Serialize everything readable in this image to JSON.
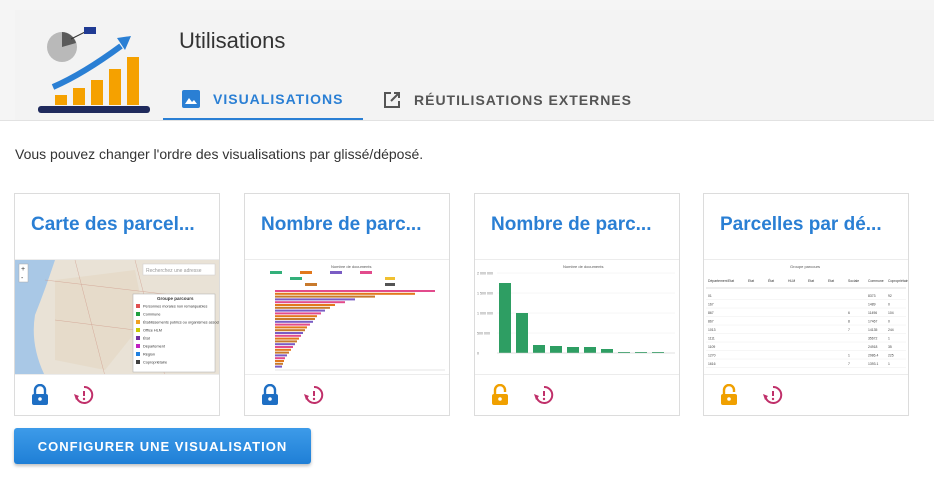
{
  "header": {
    "title": "Utilisations"
  },
  "tabs": [
    {
      "label": "VISUALISATIONS",
      "icon": "image-icon",
      "active": true
    },
    {
      "label": "RÉUTILISATIONS EXTERNES",
      "icon": "external-link-icon",
      "active": false
    }
  ],
  "hint": "Vous pouvez changer l'ordre des visualisations par glissé/déposé.",
  "cards": [
    {
      "title": "Carte des parcel...",
      "thumb_type": "map",
      "thumb": {
        "search_placeholder": "Recherchez une adresse",
        "legend_title": "Groupe parcours",
        "legend": [
          "Personnes morales non remarquables",
          "Commune",
          "Établissements publics ou organismes associés",
          "Office HLM",
          "État",
          "Département",
          "Région",
          "Copropriétaire"
        ],
        "legend_colors": [
          "#e05050",
          "#20a040",
          "#f0a020",
          "#c8c800",
          "#7030a0",
          "#c020c0",
          "#2080e0",
          "#404040"
        ]
      },
      "lock_color": "#1e6fc4",
      "lock_state": "locked"
    },
    {
      "title": "Nombre de parc...",
      "thumb_type": "hbar",
      "thumb": {
        "chart_title": "Nombre de documents"
      },
      "lock_color": "#1e6fc4",
      "lock_state": "locked"
    },
    {
      "title": "Nombre de parc...",
      "thumb_type": "vbar",
      "thumb": {
        "chart_title": "Nombre de documents",
        "y_ticks": [
          "2 000 000",
          "1 500 000",
          "1 000 000",
          "500 000",
          "0"
        ]
      },
      "lock_color": "#f0a000",
      "lock_state": "unlocked"
    },
    {
      "title": "Parcelles par dé...",
      "thumb_type": "table",
      "thumb": {
        "table_title": "Groupe parcours",
        "columns": [
          "Département",
          "Etat",
          "Etat",
          "État",
          "HLM",
          "Etat",
          "Etat",
          "Sociale",
          "Commune",
          "Copropriétaire"
        ],
        "rows": [
          [
            "01",
            "",
            "",
            "",
            "",
            "",
            "",
            "",
            "8373",
            "92"
          ],
          [
            "167",
            "",
            "",
            "",
            "",
            "",
            "",
            "",
            "1489",
            "0"
          ],
          [
            "867",
            "",
            "",
            "",
            "",
            "",
            "",
            "6",
            "11496",
            "104"
          ],
          [
            "867",
            "",
            "",
            "",
            "",
            "",
            "",
            "8",
            "17467",
            "0"
          ],
          [
            "1013",
            "",
            "",
            "",
            "",
            "",
            "",
            "7",
            "14135",
            "244"
          ],
          [
            "1111",
            "",
            "",
            "",
            "",
            "",
            "",
            "",
            "35672",
            "1"
          ],
          [
            "1109",
            "",
            "",
            "",
            "",
            "",
            "",
            "",
            "24918",
            "35"
          ],
          [
            "1270",
            "",
            "",
            "",
            "",
            "",
            "",
            "1",
            "2986.4",
            "225"
          ],
          [
            "1616",
            "",
            "",
            "",
            "",
            "",
            "",
            "7",
            "1393.1",
            "1"
          ]
        ]
      },
      "lock_color": "#f0a000",
      "lock_state": "unlocked"
    }
  ],
  "configure_button": {
    "label": "CONFIGURER UNE VISUALISATION"
  },
  "colors": {
    "accent": "#2a7fd4",
    "history": "#c0306a",
    "lock_blue": "#1e6fc4",
    "lock_orange": "#f0a000"
  }
}
